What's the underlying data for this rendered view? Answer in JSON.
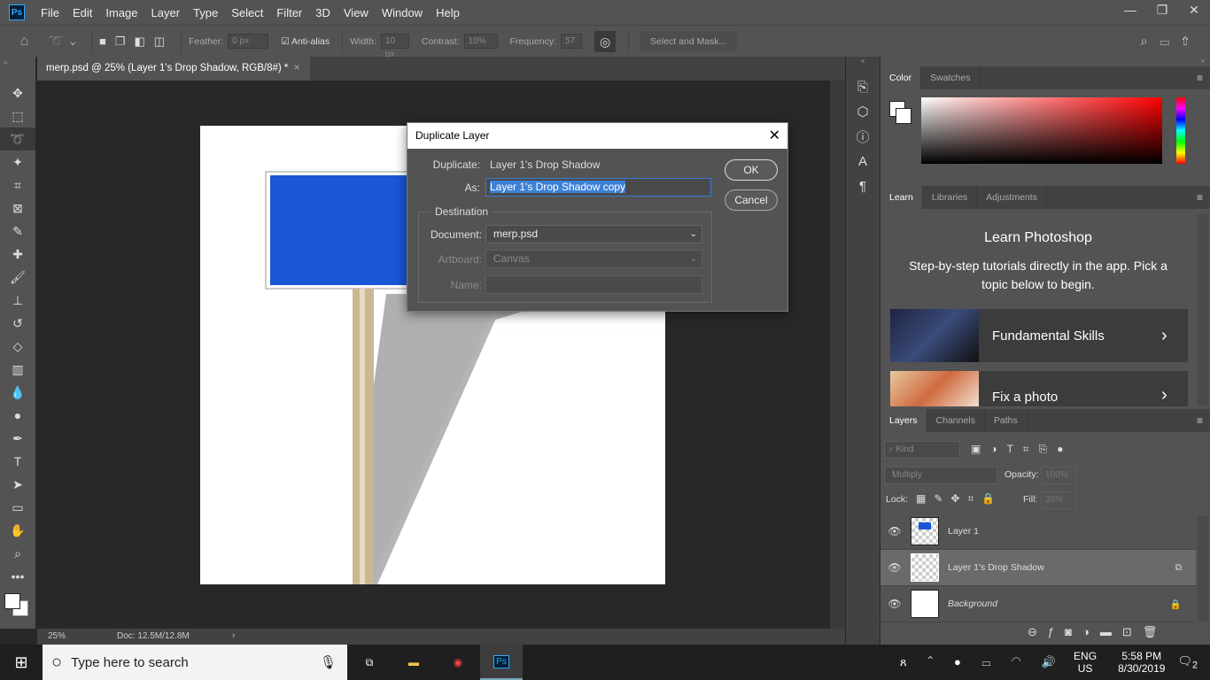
{
  "menubar": {
    "logo": "Ps",
    "items": [
      "File",
      "Edit",
      "Image",
      "Layer",
      "Type",
      "Select",
      "Filter",
      "3D",
      "View",
      "Window",
      "Help"
    ],
    "window_controls": [
      "minimize",
      "restore",
      "close"
    ]
  },
  "options": {
    "feather_label": "Feather:",
    "feather_value": "0 px",
    "antialias_label": "Anti-alias",
    "antialias_checked": true,
    "width_label": "Width:",
    "width_value": "10 px",
    "contrast_label": "Contrast:",
    "contrast_value": "10%",
    "frequency_label": "Frequency:",
    "frequency_value": "57",
    "select_mask": "Select and Mask..."
  },
  "document_tab": {
    "title": "merp.psd @ 25% (Layer 1's Drop Shadow, RGB/8#) *",
    "close": "×"
  },
  "status": {
    "zoom": "25%",
    "doc": "Doc: 12.5M/12.8M",
    "arrow": "›"
  },
  "dialog": {
    "title": "Duplicate Layer",
    "duplicate_label": "Duplicate:",
    "duplicate_value": "Layer 1's Drop Shadow",
    "as_label": "As:",
    "as_value": "Layer 1's Drop Shadow copy",
    "destination_label": "Destination",
    "document_label": "Document:",
    "document_value": "merp.psd",
    "artboard_label": "Artboard:",
    "artboard_value": "Canvas",
    "name_label": "Name:",
    "name_value": "",
    "ok": "OK",
    "cancel": "Cancel"
  },
  "color_panel": {
    "tabs": [
      "Color",
      "Swatches"
    ],
    "accent": "#ff0000"
  },
  "learn_panel": {
    "tabs": [
      "Learn",
      "Libraries",
      "Adjustments"
    ],
    "title": "Learn Photoshop",
    "subtitle": "Step-by-step tutorials directly in the app. Pick a topic below to begin.",
    "cards": [
      "Fundamental Skills",
      "Fix a photo"
    ]
  },
  "layers_panel": {
    "tabs": [
      "Layers",
      "Channels",
      "Paths"
    ],
    "kind_placeholder": "Kind",
    "blend_mode": "Multiply",
    "opacity_label": "Opacity:",
    "opacity_value": "100%",
    "lock_label": "Lock:",
    "fill_label": "Fill:",
    "fill_value": "35%",
    "layers": [
      {
        "name": "Layer 1",
        "selected": false
      },
      {
        "name": "Layer 1's Drop Shadow",
        "selected": true
      },
      {
        "name": "Background",
        "selected": false,
        "locked": true
      }
    ]
  },
  "taskbar": {
    "search_placeholder": "Type here to search",
    "lang": "ENG",
    "region": "US",
    "time": "5:58 PM",
    "date": "8/30/2019",
    "notifications": "2"
  }
}
